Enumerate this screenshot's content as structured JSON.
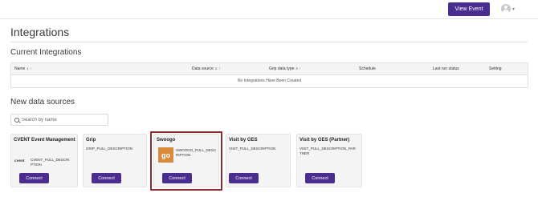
{
  "header": {
    "view_event_label": "View Event",
    "avatar_icon": "user-avatar-icon",
    "chevron_icon": "chevron-down-icon"
  },
  "page": {
    "title": "Integrations",
    "current_heading": "Current Integrations",
    "new_heading": "New data sources"
  },
  "table": {
    "columns": [
      {
        "label": "Name",
        "sort_index": "1",
        "sort_icon": "↑"
      },
      {
        "label": "Data source",
        "sort_index": "2",
        "sort_icon": "↑"
      },
      {
        "label": "Grip data type",
        "sort_index": "3",
        "sort_icon": "↑"
      },
      {
        "label": "Schedule"
      },
      {
        "label": "Last run status"
      },
      {
        "label": "Setting"
      }
    ],
    "empty_message": "No Integrations Have Been Created"
  },
  "search": {
    "placeholder": "Search by name",
    "value": ""
  },
  "sources": [
    {
      "title": "CVENT Event Management",
      "logo_text": "cvent",
      "description": "CVENT_PULL_DESCRIPTION",
      "button": "Connect"
    },
    {
      "title": "Grip",
      "description": "GRIP_PULL_DESCRIPTION",
      "button": "Connect"
    },
    {
      "title": "Swoogo",
      "logo_text": "go",
      "description": "SWOOGO_PULL_DESCRIPTION",
      "button": "Connect",
      "selected": true
    },
    {
      "title": "Visit by GES",
      "description": "VISIT_PULL_DESCRIPTION",
      "button": "Connect"
    },
    {
      "title": "Visit by GES (Partner)",
      "description": "VISIT_PULL_DESCRIPTION_PARTNER",
      "button": "Connect"
    }
  ],
  "colors": {
    "accent": "#4b2d8f",
    "selection_border": "#8e2a2a",
    "swoogo_logo": "#d98a3d"
  }
}
